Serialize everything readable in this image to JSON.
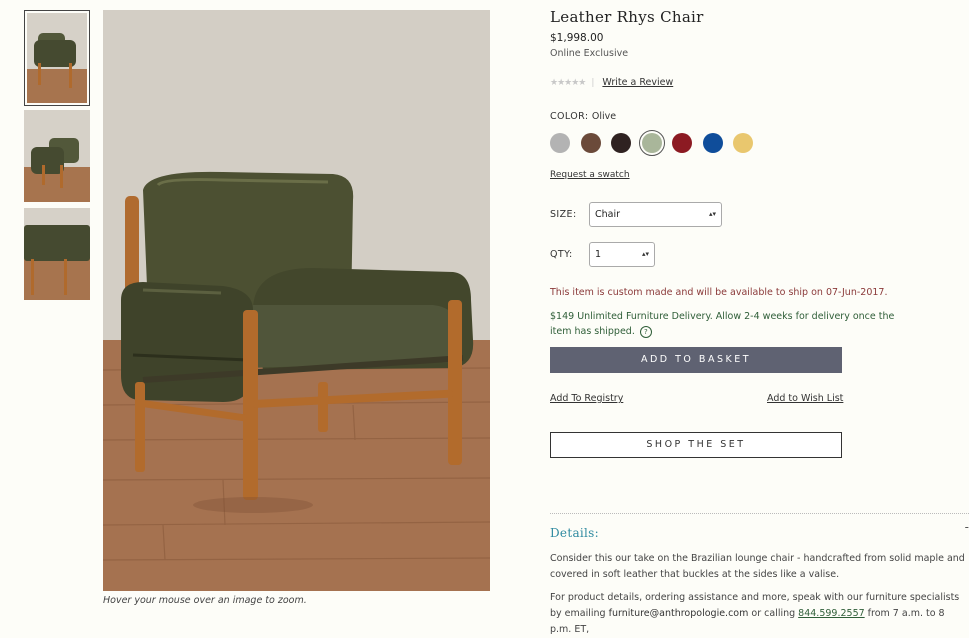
{
  "product": {
    "title": "Leather Rhys Chair",
    "price": "$1,998.00",
    "exclusive": "Online Exclusive",
    "stars": "★★★★★",
    "separator": "|",
    "write_review": "Write a Review"
  },
  "color": {
    "label": "COLOR:",
    "selected": "Olive",
    "swatches": [
      {
        "name": "gray",
        "hex": "#b3b3b3"
      },
      {
        "name": "brown",
        "hex": "#6b4a3a"
      },
      {
        "name": "dark-brown",
        "hex": "#2f2221"
      },
      {
        "name": "olive",
        "hex": "#a9b69a"
      },
      {
        "name": "red",
        "hex": "#8c1a22"
      },
      {
        "name": "blue",
        "hex": "#0f4d9a"
      },
      {
        "name": "yellow",
        "hex": "#e9c76e"
      }
    ],
    "request_swatch": "Request a swatch"
  },
  "size": {
    "label": "SIZE:",
    "value": "Chair"
  },
  "qty": {
    "label": "QTY:",
    "value": "1"
  },
  "arrow": "▴▾",
  "messages": {
    "custom": "This item is custom made and will be available to ship on 07-Jun-2017.",
    "delivery": "$149 Unlimited Furniture Delivery. Allow 2-4 weeks for delivery once the item has shipped.",
    "help": "?"
  },
  "actions": {
    "add_to_basket": "ADD TO BASKET",
    "add_to_registry": "Add To Registry",
    "add_to_wishlist": "Add to Wish List",
    "shop_the_set": "SHOP THE SET"
  },
  "details": {
    "heading": "Details:",
    "toggle": "-",
    "description": "Consider this our take on the Brazilian lounge chair - handcrafted from solid maple and covered in soft leather that buckles at the sides like a valise.",
    "contact_prefix": "For product details, ordering assistance and more, speak with our furniture specialists by emailing ",
    "email": "furniture@anthropologie.com",
    "contact_middle": " or calling ",
    "phone": "844.599.2557",
    "contact_suffix": " from 7 a.m. to 8 p.m. ET,"
  },
  "zoom_hint": "Hover your mouse over an image to zoom."
}
